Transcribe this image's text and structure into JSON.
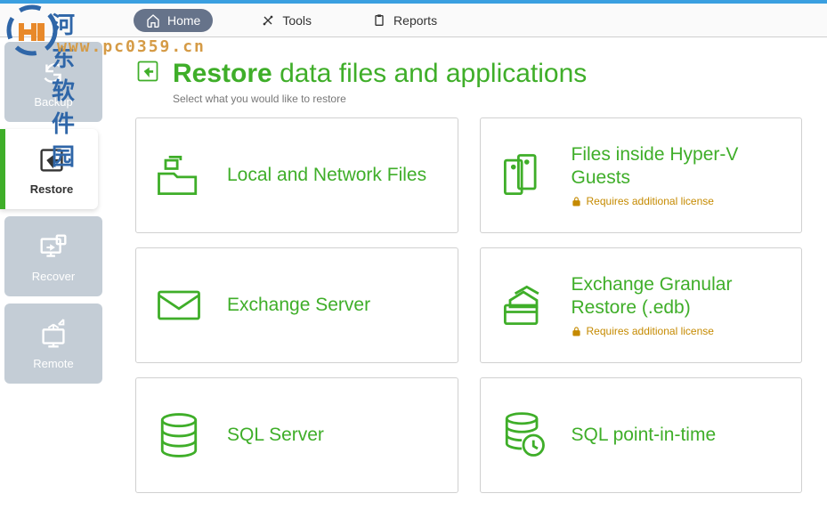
{
  "watermark": {
    "text1": "河东软件园",
    "text2": "www.pc0359.cn"
  },
  "tabs": {
    "home": "Home",
    "tools": "Tools",
    "reports": "Reports"
  },
  "sidebar": {
    "backup": "Backup",
    "restore": "Restore",
    "recover": "Recover",
    "remote": "Remote"
  },
  "heading": {
    "title_bold": "Restore",
    "title_rest": "data files and applications",
    "subtitle": "Select what you would like to restore"
  },
  "license_note": "Requires additional license",
  "cards": {
    "local": "Local and Network Files",
    "hyperv": "Files inside Hyper-V Guests",
    "exchange": "Exchange Server",
    "exchange_edb": "Exchange Granular Restore (.edb)",
    "sql": "SQL Server",
    "sql_pit": "SQL point-in-time"
  }
}
